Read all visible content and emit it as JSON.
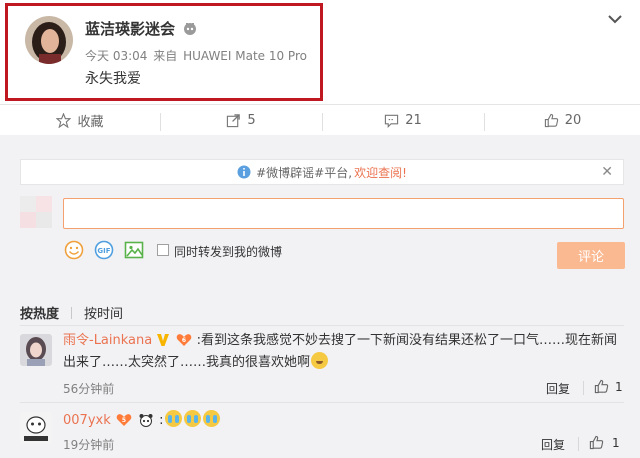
{
  "post": {
    "username": "蓝洁瑛影迷会",
    "time": "今天 03:04",
    "via": "来自",
    "device": "HUAWEI Mate 10 Pro",
    "text": "永失我爱"
  },
  "actions": {
    "favorite": "收藏",
    "repost_count": "5",
    "comment_count": "21",
    "like_count": "20"
  },
  "notice": {
    "text": "#微博辟谣#平台,",
    "link": "欢迎查阅!"
  },
  "compose": {
    "input_value": "",
    "repost_label": "同时转发到我的微博",
    "submit_label": "评论"
  },
  "sort": {
    "hot": "按热度",
    "time": "按时间"
  },
  "comments": [
    {
      "user": "雨令-Lainkana",
      "text_line1": ":看到这条我感觉不妙去搜了一下新闻没有结果还松了一口气……现在新闻",
      "text_line2": "出来了……太突然了……我真的很喜欢她啊",
      "time": "56分钟前",
      "reply": "回复",
      "likes": "1"
    },
    {
      "user": "007yxk",
      "text": ":",
      "time": "19分钟前",
      "reply": "回复",
      "likes": "1"
    }
  ],
  "colors": {
    "accent": "#eb7350",
    "highlight_border": "#c01820",
    "submit_bg": "#fbb992",
    "panel_bg": "#f2f2f5"
  }
}
